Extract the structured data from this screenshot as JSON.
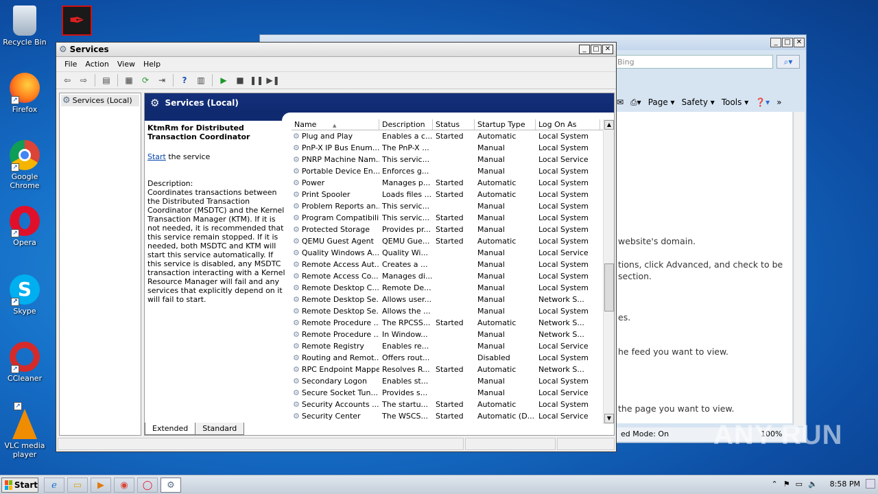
{
  "desktop": {
    "icons": [
      {
        "label": "Recycle Bin",
        "icon": "recycle-bin-icon"
      },
      {
        "label": "Firefox",
        "icon": "firefox-icon"
      },
      {
        "label": "Google Chrome",
        "icon": "chrome-icon"
      },
      {
        "label": "Opera",
        "icon": "opera-icon"
      },
      {
        "label": "Skype",
        "icon": "skype-icon"
      },
      {
        "label": "CCleaner",
        "icon": "ccleaner-icon"
      },
      {
        "label": "VLC media player",
        "icon": "vlc-icon"
      }
    ],
    "watermark": "ANY RUN"
  },
  "ie": {
    "search_placeholder": "Bing",
    "cmd": {
      "page": "Page ▾",
      "safety": "Safety ▾",
      "tools": "Tools ▾"
    },
    "text_lines": [
      "website's domain.",
      "tions, click Advanced, and check to be",
      "section.",
      "es.",
      "he feed you want to view.",
      "the page you want to view."
    ],
    "status": "ed Mode: On",
    "zoom": "100%"
  },
  "services": {
    "title": "Services",
    "menu": [
      "File",
      "Action",
      "View",
      "Help"
    ],
    "tree_item": "Services (Local)",
    "pane_title": "Services (Local)",
    "selected": {
      "name": "KtmRm for Distributed Transaction Coordinator",
      "start_link": "Start",
      "start_suffix": " the service",
      "desc_label": "Description:",
      "description": "Coordinates transactions between the Distributed Transaction Coordinator (MSDTC) and the Kernel Transaction Manager (KTM). If it is not needed, it is recommended that this service remain stopped. If it is needed, both MSDTC and KTM will start this service automatically. If this service is disabled, any MSDTC transaction interacting with a Kernel Resource Manager will fail and any services that explicitly depend on it will fail to start."
    },
    "columns": [
      "Name",
      "Description",
      "Status",
      "Startup Type",
      "Log On As"
    ],
    "rows": [
      [
        "Plug and Play",
        "Enables a c...",
        "Started",
        "Automatic",
        "Local System"
      ],
      [
        "PnP-X IP Bus Enum...",
        "The PnP-X ...",
        "",
        "Manual",
        "Local System"
      ],
      [
        "PNRP Machine Nam...",
        "This servic...",
        "",
        "Manual",
        "Local Service"
      ],
      [
        "Portable Device En...",
        "Enforces g...",
        "",
        "Manual",
        "Local System"
      ],
      [
        "Power",
        "Manages p...",
        "Started",
        "Automatic",
        "Local System"
      ],
      [
        "Print Spooler",
        "Loads files ...",
        "Started",
        "Automatic",
        "Local System"
      ],
      [
        "Problem Reports an...",
        "This servic...",
        "",
        "Manual",
        "Local System"
      ],
      [
        "Program Compatibili...",
        "This servic...",
        "Started",
        "Manual",
        "Local System"
      ],
      [
        "Protected Storage",
        "Provides pr...",
        "Started",
        "Manual",
        "Local System"
      ],
      [
        "QEMU Guest Agent",
        "QEMU Gue...",
        "Started",
        "Automatic",
        "Local System"
      ],
      [
        "Quality Windows A...",
        "Quality Wi...",
        "",
        "Manual",
        "Local Service"
      ],
      [
        "Remote Access Aut...",
        "Creates a ...",
        "",
        "Manual",
        "Local System"
      ],
      [
        "Remote Access Co...",
        "Manages di...",
        "",
        "Manual",
        "Local System"
      ],
      [
        "Remote Desktop C...",
        "Remote De...",
        "",
        "Manual",
        "Local System"
      ],
      [
        "Remote Desktop Se...",
        "Allows user...",
        "",
        "Manual",
        "Network S..."
      ],
      [
        "Remote Desktop Se...",
        "Allows the ...",
        "",
        "Manual",
        "Local System"
      ],
      [
        "Remote Procedure ...",
        "The RPCSS...",
        "Started",
        "Automatic",
        "Network S..."
      ],
      [
        "Remote Procedure ...",
        "In Window...",
        "",
        "Manual",
        "Network S..."
      ],
      [
        "Remote Registry",
        "Enables re...",
        "",
        "Manual",
        "Local Service"
      ],
      [
        "Routing and Remot...",
        "Offers rout...",
        "",
        "Disabled",
        "Local System"
      ],
      [
        "RPC Endpoint Mapper",
        "Resolves R...",
        "Started",
        "Automatic",
        "Network S..."
      ],
      [
        "Secondary Logon",
        "Enables st...",
        "",
        "Manual",
        "Local System"
      ],
      [
        "Secure Socket Tun...",
        "Provides s...",
        "",
        "Manual",
        "Local Service"
      ],
      [
        "Security Accounts ...",
        "The startu...",
        "Started",
        "Automatic",
        "Local System"
      ],
      [
        "Security Center",
        "The WSCS...",
        "Started",
        "Automatic (D...",
        "Local Service"
      ]
    ],
    "tabs": [
      "Extended",
      "Standard"
    ]
  },
  "taskbar": {
    "start": "Start",
    "clock": "8:58 PM"
  }
}
